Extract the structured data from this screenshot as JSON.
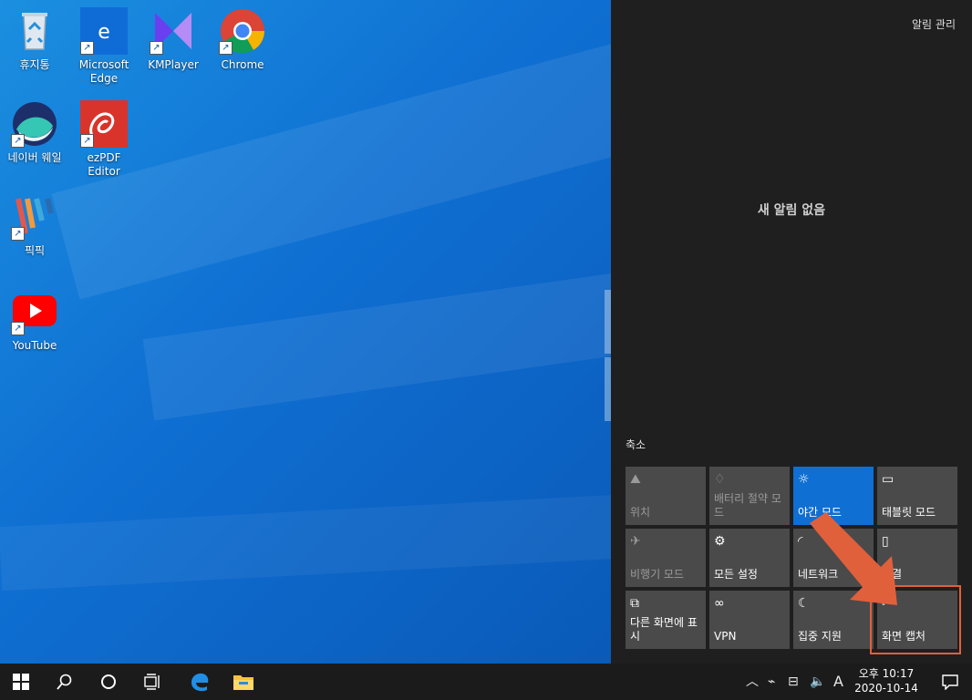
{
  "desktop": {
    "icons": [
      {
        "label": "휴지통",
        "icon": "recycle-bin-icon"
      },
      {
        "label": "Microsoft Edge",
        "icon": "edge-icon"
      },
      {
        "label": "KMPlayer",
        "icon": "kmplayer-icon"
      },
      {
        "label": "Chrome",
        "icon": "chrome-icon"
      },
      {
        "label": "네이버 웨일",
        "icon": "whale-icon"
      },
      {
        "label": "ezPDF Editor",
        "icon": "ezpdf-icon"
      },
      {
        "label": "픽픽",
        "icon": "picpick-icon"
      },
      {
        "label": "YouTube",
        "icon": "youtube-icon"
      }
    ]
  },
  "action_center": {
    "manage_label": "알림 관리",
    "empty_message": "새 알림 없음",
    "collapse_label": "축소",
    "tiles": [
      {
        "label": "위치",
        "icon": "location-icon",
        "state": "disabled"
      },
      {
        "label": "배터리 절약 모드",
        "icon": "battery-saver-icon",
        "state": "disabled"
      },
      {
        "label": "야간 모드",
        "icon": "night-light-icon",
        "state": "on"
      },
      {
        "label": "태블릿 모드",
        "icon": "tablet-mode-icon",
        "state": "off"
      },
      {
        "label": "비행기 모드",
        "icon": "airplane-icon",
        "state": "disabled"
      },
      {
        "label": "모든 설정",
        "icon": "gear-icon",
        "state": "off"
      },
      {
        "label": "네트워크",
        "icon": "network-icon",
        "state": "off"
      },
      {
        "label": "연결",
        "icon": "connect-icon",
        "state": "off"
      },
      {
        "label": "다른 화면에 표시",
        "icon": "project-icon",
        "state": "off"
      },
      {
        "label": "VPN",
        "icon": "vpn-icon",
        "state": "off"
      },
      {
        "label": "집중 지원",
        "icon": "focus-assist-icon",
        "state": "off"
      },
      {
        "label": "화면 캡처",
        "icon": "screen-snip-icon",
        "state": "off"
      }
    ]
  },
  "taskbar": {
    "ime_label": "A",
    "time": "오후 10:17",
    "date": "2020-10-14"
  },
  "colors": {
    "accent": "#0f6fd2",
    "highlight": "#e0603c",
    "panel_bg": "#1f1f1f",
    "tile_bg": "#4a4a4a"
  }
}
